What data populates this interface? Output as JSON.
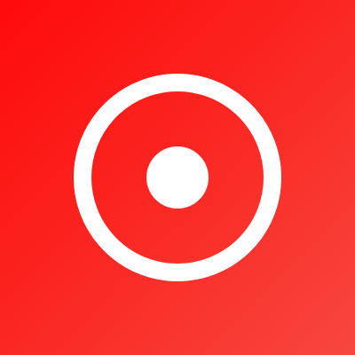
{
  "app_icon": {
    "name": "record-icon",
    "colors": {
      "background_start": "#fe0b0a",
      "background_mid": "#fb2420",
      "background_end": "#f7473f",
      "glyph": "#ffffff"
    }
  }
}
